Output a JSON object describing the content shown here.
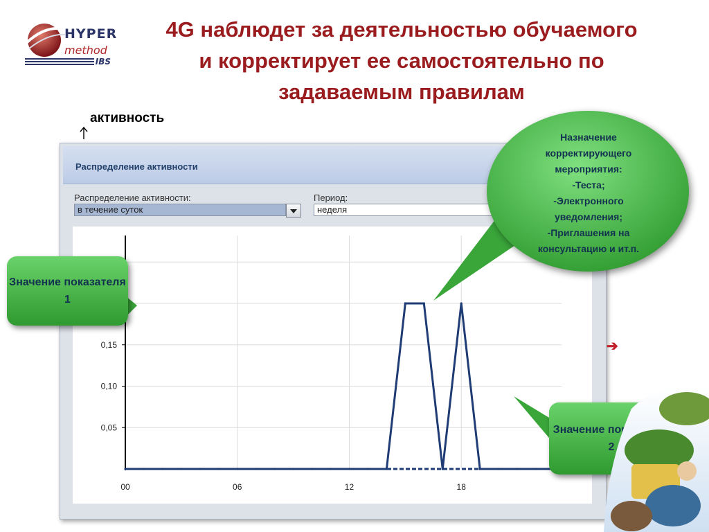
{
  "logo": {
    "line1": "HYPER",
    "line2": "method",
    "line3": "IBS"
  },
  "title": {
    "line1": "4G наблюдет за деятельностью обучаемого",
    "line2": "и корректирует ее самостоятельно по",
    "line3": "задаваемым правилам"
  },
  "axis_caption": "активность",
  "panel": {
    "title": "Распределение активности",
    "distribution_label": "Распределение активности:",
    "distribution_value": "в течение суток",
    "period_label": "Период:",
    "period_value": "неделя"
  },
  "chart_data": {
    "type": "line",
    "x_ticks": [
      "00",
      "06",
      "12",
      "18"
    ],
    "y_ticks": [
      "0,05",
      "0,10",
      "0,15"
    ],
    "xlim": [
      0,
      23
    ],
    "ylim": [
      0,
      0.2
    ],
    "grid": true,
    "series": [
      {
        "color": "#1f3c75",
        "x": [
          0,
          1,
          2,
          3,
          4,
          5,
          6,
          7,
          8,
          9,
          10,
          11,
          12,
          13,
          14,
          15,
          16,
          17,
          18,
          19,
          20,
          21,
          22,
          23
        ],
        "values": [
          0,
          0,
          0,
          0,
          0,
          0,
          0,
          0,
          0,
          0,
          0,
          0,
          0,
          0,
          0,
          0.2,
          0.2,
          0,
          0.2,
          0,
          0,
          0,
          0,
          0
        ]
      }
    ]
  },
  "callouts": {
    "indicator1": "Значение показателя 1",
    "indicator2": "Значение показателя 2",
    "bubble": [
      "Назначение",
      "корректирующего",
      "мероприятия:",
      "-Теста;",
      "-Электронного",
      "уведомления;",
      "-Приглашения на",
      "консультацию и ит.п."
    ]
  },
  "colors": {
    "title": "#9b1c1f",
    "callout_green": "#3fae3f",
    "line": "#1f3c75"
  }
}
